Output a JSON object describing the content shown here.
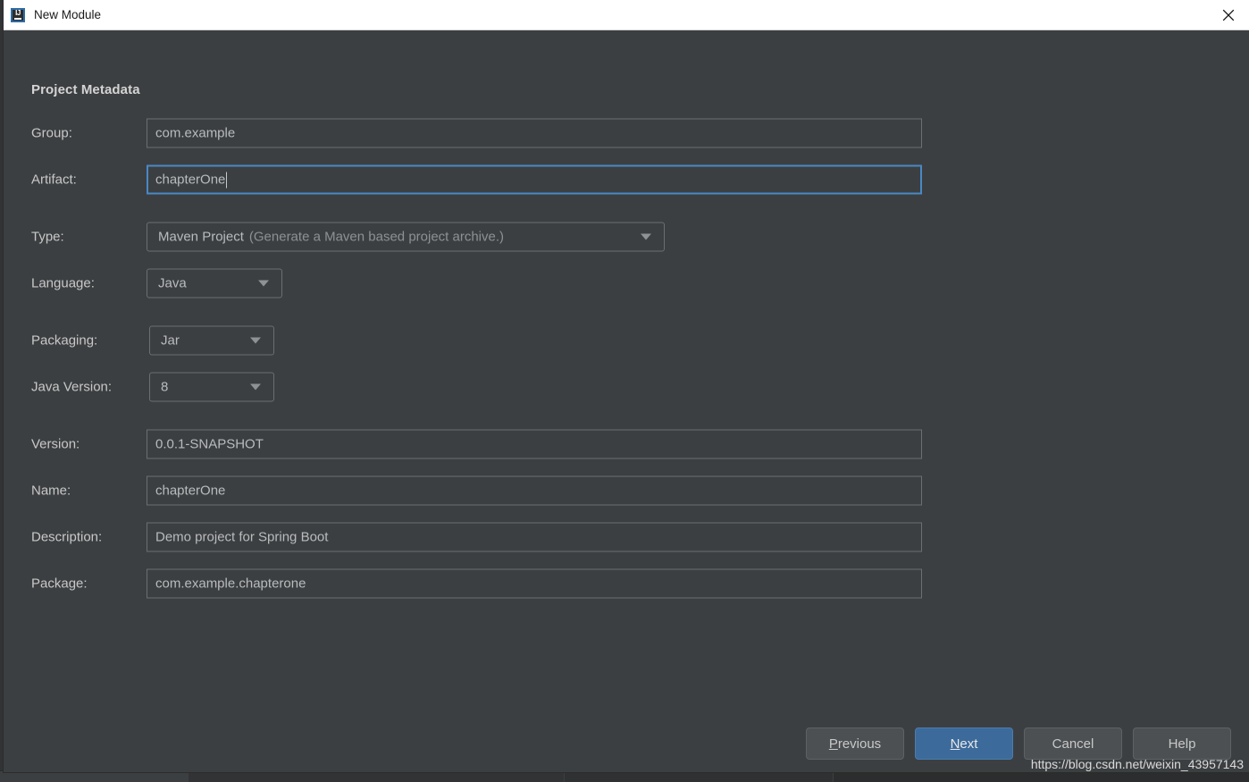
{
  "window": {
    "title": "New Module",
    "icon": "intellij-idea-icon",
    "icon_glyph": "IJ",
    "close_icon": "close-icon"
  },
  "section": {
    "title": "Project Metadata"
  },
  "fields": {
    "group": {
      "label": "Group:",
      "value": "com.example",
      "type": "text",
      "focused": false
    },
    "artifact": {
      "label": "Artifact:",
      "value": "chapterOne",
      "type": "text",
      "focused": true
    },
    "type": {
      "label": "Type:",
      "value": "Maven Project",
      "hint": "(Generate a Maven based project archive.)",
      "type": "combo"
    },
    "language": {
      "label": "Language:",
      "value": "Java",
      "type": "combo"
    },
    "packaging": {
      "label": "Packaging:",
      "value": "Jar",
      "type": "combo"
    },
    "java_version": {
      "label": "Java Version:",
      "value": "8",
      "type": "combo"
    },
    "version": {
      "label": "Version:",
      "value": "0.0.1-SNAPSHOT",
      "type": "text",
      "focused": false
    },
    "name": {
      "label": "Name:",
      "value": "chapterOne",
      "type": "text",
      "focused": false
    },
    "description": {
      "label": "Description:",
      "value": "Demo project for Spring Boot",
      "type": "text",
      "focused": false
    },
    "package": {
      "label": "Package:",
      "value": "com.example.chapterone",
      "type": "text",
      "focused": false
    }
  },
  "buttons": {
    "previous": {
      "mnemonic": "P",
      "rest": "revious"
    },
    "next": {
      "mnemonic": "N",
      "rest": "ext"
    },
    "cancel": {
      "label": "Cancel"
    },
    "help": {
      "label": "Help"
    }
  },
  "watermark": {
    "text": "https://blog.csdn.net/weixin_43957143"
  },
  "colors": {
    "dialog_bg": "#3c3f41",
    "titlebar_bg": "#ffffff",
    "focus_border": "#4a88c7",
    "primary_button": "#3c6a9b",
    "text": "#c8c8c8",
    "hint_text": "#8e9194"
  }
}
